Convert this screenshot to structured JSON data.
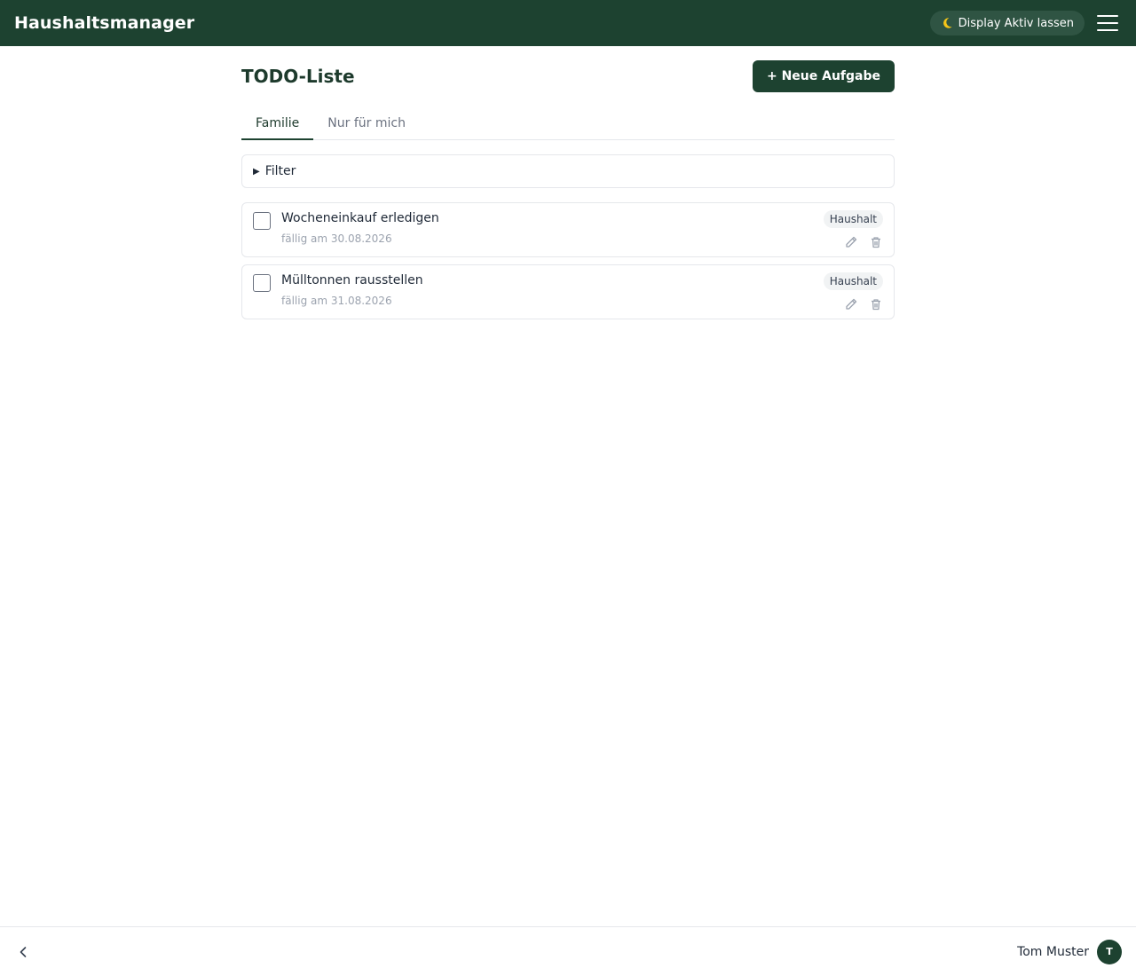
{
  "app": {
    "title": "Haushaltsmanager"
  },
  "topbar": {
    "display_toggle_label": "Display Aktiv lassen",
    "display_toggle_icon": "moon-icon",
    "menu_icon": "hamburger-menu-icon"
  },
  "page": {
    "title": "TODO-Liste",
    "new_task_label": "+ Neue Aufgabe"
  },
  "tabs": [
    {
      "label": "Familie",
      "active": true
    },
    {
      "label": "Nur für mich",
      "active": false
    }
  ],
  "filter": {
    "label": "Filter",
    "expanded": false
  },
  "tasks": [
    {
      "title": "Wocheneinkauf erledigen",
      "due": "fällig am 30.08.2026",
      "tag": "Haushalt",
      "done": false
    },
    {
      "title": "Mülltonnen rausstellen",
      "due": "fällig am 31.08.2026",
      "tag": "Haushalt",
      "done": false
    }
  ],
  "footer": {
    "user_name": "Tom Muster",
    "avatar_initial": "T"
  },
  "colors": {
    "brand": "#1d4230",
    "tag_bg": "#f1f3f4",
    "muted_text": "#9ca3af"
  }
}
